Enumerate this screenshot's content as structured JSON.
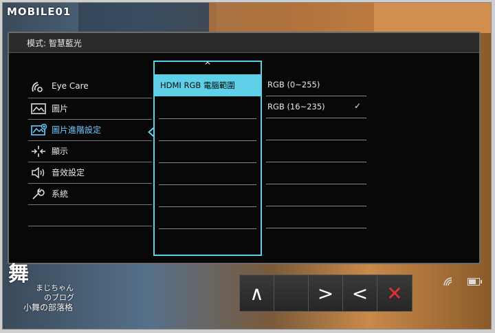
{
  "watermark_top": "MOBILE01",
  "osd": {
    "header": "模式: 智慧藍光",
    "menu": [
      {
        "label": "Eye Care",
        "icon": "eye-care-icon",
        "active": false
      },
      {
        "label": "圖片",
        "icon": "picture-icon",
        "active": false
      },
      {
        "label": "圖片進階設定",
        "icon": "picture-advanced-icon",
        "active": true
      },
      {
        "label": "顯示",
        "icon": "display-icon",
        "active": false
      },
      {
        "label": "音效設定",
        "icon": "audio-icon",
        "active": false
      },
      {
        "label": "系統",
        "icon": "system-wrench-icon",
        "active": false
      }
    ],
    "submenu": {
      "scroll_up": "^",
      "items": [
        "HDMI RGB 電腦範圍",
        "",
        "",
        "",
        "",
        "",
        "",
        ""
      ],
      "selected_index": 0
    },
    "options": [
      {
        "label": "RGB (0~255)",
        "checked": false
      },
      {
        "label": "RGB (16~235)",
        "checked": true
      },
      {
        "label": "",
        "checked": false
      },
      {
        "label": "",
        "checked": false
      },
      {
        "label": "",
        "checked": false
      },
      {
        "label": "",
        "checked": false
      },
      {
        "label": "",
        "checked": false
      }
    ],
    "checkmark": "✓"
  },
  "keys": [
    {
      "name": "up",
      "glyph": "∧"
    },
    {
      "name": "blank",
      "glyph": ""
    },
    {
      "name": "right",
      "glyph": ">"
    },
    {
      "name": "left",
      "glyph": "<"
    },
    {
      "name": "close",
      "glyph": "✕"
    }
  ],
  "watermark_bottom": {
    "big": "舞",
    "line1": "まじちゃん",
    "line2": "のブログ",
    "line3": "小舞の部落格"
  },
  "colors": {
    "accent": "#5ed0e8",
    "active_text": "#6fc9ff",
    "close": "#e5322e"
  }
}
